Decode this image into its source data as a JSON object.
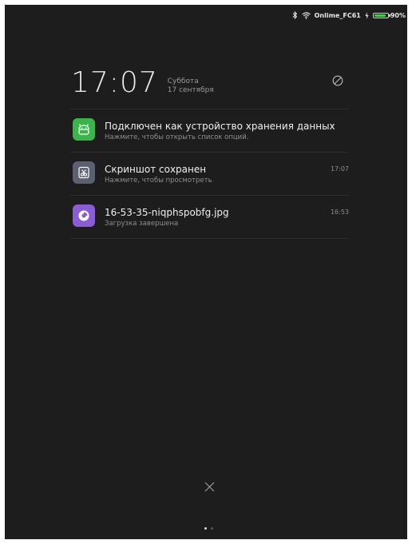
{
  "status_bar": {
    "carrier": "Onlime_FC61",
    "battery": "90%",
    "battery_level": 0.9
  },
  "lock": {
    "time": "17:07",
    "weekday": "Суббота",
    "date": "17 сентября"
  },
  "notifications": [
    {
      "icon": "android-icon",
      "icon_color": "#39b54a",
      "title": "Подключен как устройство хранения данных",
      "subtitle": "Нажмите, чтобы открыть список опций.",
      "time": ""
    },
    {
      "icon": "screenshot-icon",
      "icon_color": "#5b6170",
      "title": "Скриншот сохранен",
      "subtitle": "Нажмите, чтобы просмотреть",
      "time": "17:07"
    },
    {
      "icon": "download-icon",
      "icon_color": "#8a5cd6",
      "title": "16-53-35-niqphspobfg.jpg",
      "subtitle": "Загрузка завершена",
      "time": "16:53"
    }
  ],
  "pager": {
    "pages": 2,
    "current": 1
  }
}
